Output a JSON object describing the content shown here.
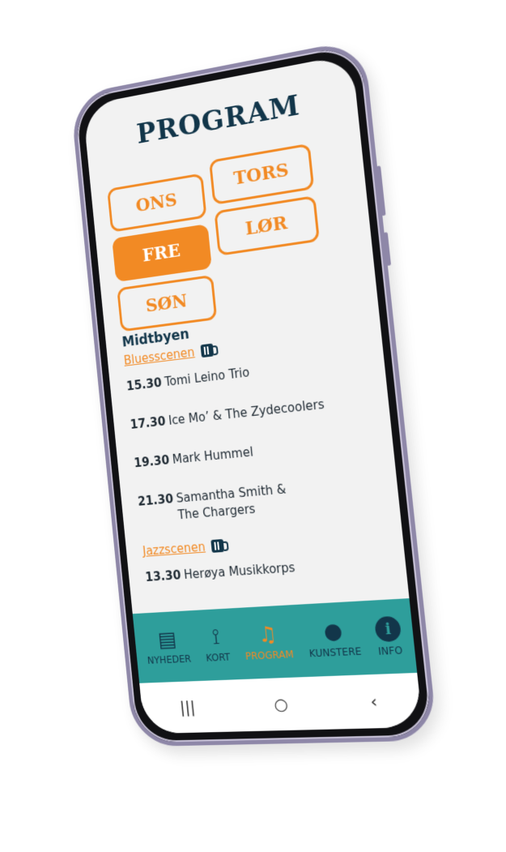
{
  "header": {
    "title": "PROGRAM"
  },
  "days": [
    {
      "label": "ONS",
      "active": false
    },
    {
      "label": "TORS",
      "active": false
    },
    {
      "label": "FRE",
      "active": true
    },
    {
      "label": "LØR",
      "active": false
    },
    {
      "label": "SØN",
      "active": false
    }
  ],
  "program": {
    "area": "Midtbyen",
    "scenes": [
      {
        "name": "Bluesscenen",
        "icon": "beer-mug-icon",
        "events": [
          {
            "time": "15.30",
            "artist": "Tomi Leino Trio"
          },
          {
            "time": "17.30",
            "artist": "Ice Mo’ & The Zydecoolers"
          },
          {
            "time": "19.30",
            "artist": "Mark Hummel"
          },
          {
            "time": "21.30",
            "artist": "Samantha Smith & The Chargers"
          }
        ]
      },
      {
        "name": "Jazzscenen",
        "icon": "beer-mug-icon",
        "events": [
          {
            "time": "13.30",
            "artist": "Herøya Musikkorps"
          }
        ]
      }
    ]
  },
  "nav": [
    {
      "label": "NYHEDER",
      "icon": "newspaper-icon",
      "active": false
    },
    {
      "label": "KORT",
      "icon": "route-icon",
      "active": false
    },
    {
      "label": "PROGRAM",
      "icon": "music-note-icon",
      "active": true
    },
    {
      "label": "KUNSTERE",
      "icon": "person-icon",
      "active": false
    },
    {
      "label": "INFO",
      "icon": "info-icon",
      "active": false
    }
  ],
  "system_nav": {
    "recents": "|||",
    "home": "○",
    "back": "‹"
  },
  "colors": {
    "accent": "#f28a24",
    "dark": "#12364a",
    "teal": "#2e9e9b",
    "screen_bg": "#f2f2f2"
  }
}
